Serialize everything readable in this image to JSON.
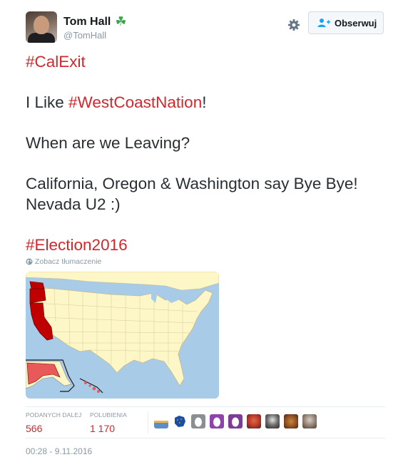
{
  "user": {
    "name": "Tom Hall",
    "name_emoji": "☘",
    "handle": "@TomHall"
  },
  "follow_button": {
    "label": "Obserwuj"
  },
  "tweet": {
    "line1_hashtag": "#CalExit",
    "line2_prefix": "I Like ",
    "line2_hashtag": "#WestCoastNation",
    "line2_suffix": "!",
    "line3": "When are we Leaving?",
    "line4": "California, Oregon & Washington say Bye Bye!",
    "line5": "Nevada U2 :)",
    "line6_hashtag": "#Election2016"
  },
  "translate_link": "Zobacz tłumaczenie",
  "stats": {
    "retweets_label": "PODANYCH DALEJ",
    "retweets_value": "566",
    "likes_label": "POLUBIENIA",
    "likes_value": "1 170"
  },
  "timestamp": "00:28 - 9.11.2016",
  "colors": {
    "hashtag": "#d0282c",
    "map_highlight": "#c00000",
    "map_land": "#fdf7c8",
    "map_water": "#a8cbe8"
  }
}
